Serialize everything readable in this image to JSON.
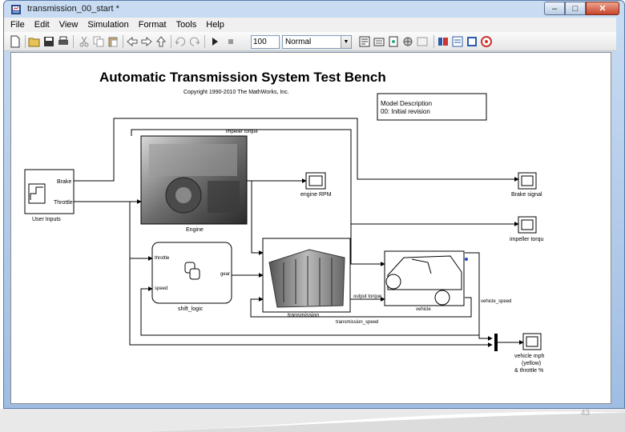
{
  "window": {
    "title": "transmission_00_start *",
    "controls": [
      "–",
      "□",
      "✕"
    ],
    "icon": "simulink-model-icon"
  },
  "menubar": {
    "items": [
      "File",
      "Edit",
      "View",
      "Simulation",
      "Format",
      "Tools",
      "Help"
    ]
  },
  "toolbar": {
    "stop_time": "100",
    "sim_mode": "Normal",
    "icons": [
      "new-icon",
      "open-icon",
      "save-icon",
      "print-icon",
      "cut-icon",
      "copy-icon",
      "paste-icon",
      "back-icon",
      "forward-icon",
      "up-icon",
      "undo-icon",
      "redo-icon",
      "play-icon",
      "stop-icon",
      "build-icon",
      "library-icon",
      "model-explorer-icon",
      "debug-icon",
      "update-icon",
      "sample-time-icon",
      "report-icon",
      "config-icon",
      "target-icon"
    ]
  },
  "model": {
    "title": "Automatic Transmission System Test Bench",
    "copyright": "Copyright 1990-2010 The MathWorks, Inc.",
    "description_line1": "Model Description",
    "description_line2": "00: Initial revision",
    "blocks": {
      "user_inputs": "User Inputs",
      "brake_port": "Brake",
      "throttle_port": "Throttle",
      "engine": "Engine",
      "engine_rpm": "engine RPM",
      "brake_signal": "Brake signal",
      "impeller_scope": "impeller torqu",
      "shift_logic": "shift_logic",
      "throttle_in": "throttle",
      "speed_in": "speed",
      "gear_out": "gear",
      "transmission": "transmission",
      "vehicle": "vehicle",
      "scope_mux_1": "vehicle mph",
      "scope_mux_2": "(yellow)",
      "scope_mux_3": "& throttle %"
    },
    "signals": {
      "impeller_torque": "impeller torque",
      "output_torque": "output torque",
      "transmission_speed": "transmission_speed",
      "vehicle_speed": "vehicle_speed"
    }
  },
  "page": {
    "number": "43"
  },
  "colors": {
    "title_blue": "#c9dcf2",
    "close_red": "#c7432a",
    "line": "#000000"
  }
}
